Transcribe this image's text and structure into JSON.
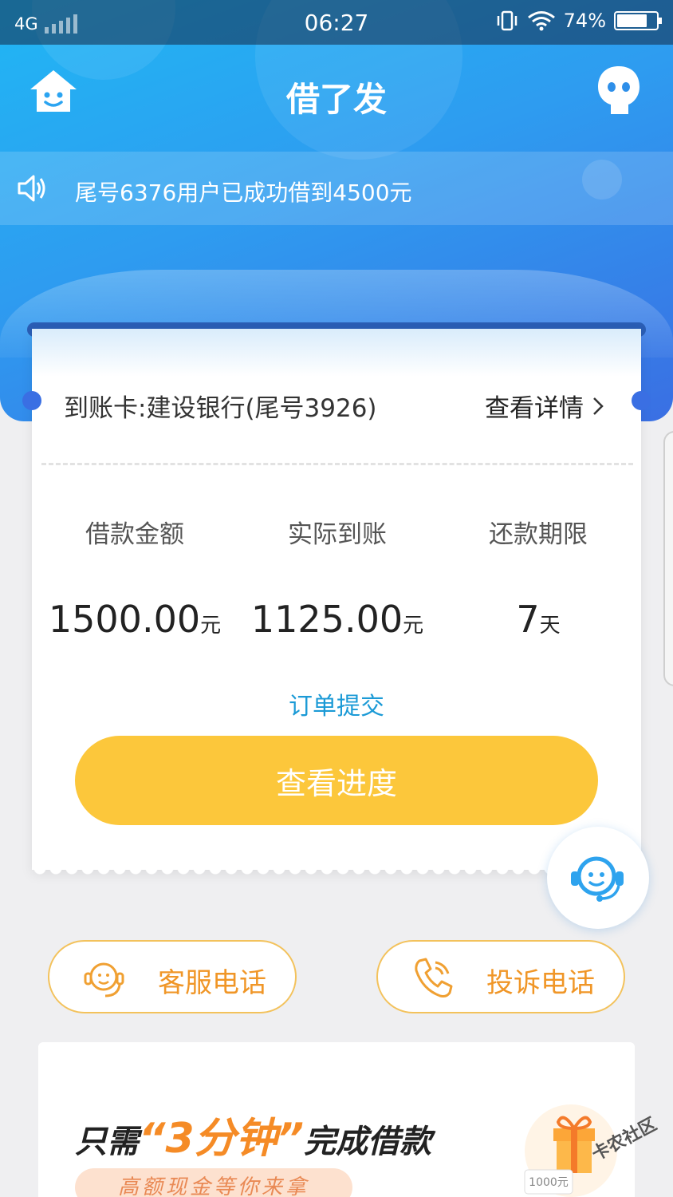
{
  "status_bar": {
    "network": "4G",
    "time": "06:27",
    "battery": "74%"
  },
  "header": {
    "title": "借了发"
  },
  "notice": {
    "text": "尾号6376用户已成功借到4500元"
  },
  "loan_card": {
    "card_label": "到账卡:建设银行(尾号3926)",
    "detail_link": "查看详情",
    "columns": [
      {
        "label": "借款金额",
        "value": "1500.00",
        "unit": "元"
      },
      {
        "label": "实际到账",
        "value": "1125.00",
        "unit": "元"
      },
      {
        "label": "还款期限",
        "value": "7",
        "unit": "天"
      }
    ],
    "status": "订单提交",
    "progress_button": "查看进度"
  },
  "contact": {
    "service_phone": "客服电话",
    "complaint_phone": "投诉电话"
  },
  "promo": {
    "prefix": "只需",
    "highlight": "“3分钟”",
    "suffix": "完成借款",
    "subtitle": "高额现金等你来拿",
    "gift_label": "1000元"
  },
  "watermark": "卡农社区",
  "colors": {
    "primary_blue": "#2e9cf0",
    "button_yellow": "#fcc73b",
    "accent_orange": "#f58b26",
    "link_blue": "#1b9ad6"
  },
  "icons": [
    "home-face-icon",
    "robot-icon",
    "speaker-icon",
    "chevron-right-icon",
    "customer-service-icon",
    "phone-icon",
    "gift-icon"
  ]
}
